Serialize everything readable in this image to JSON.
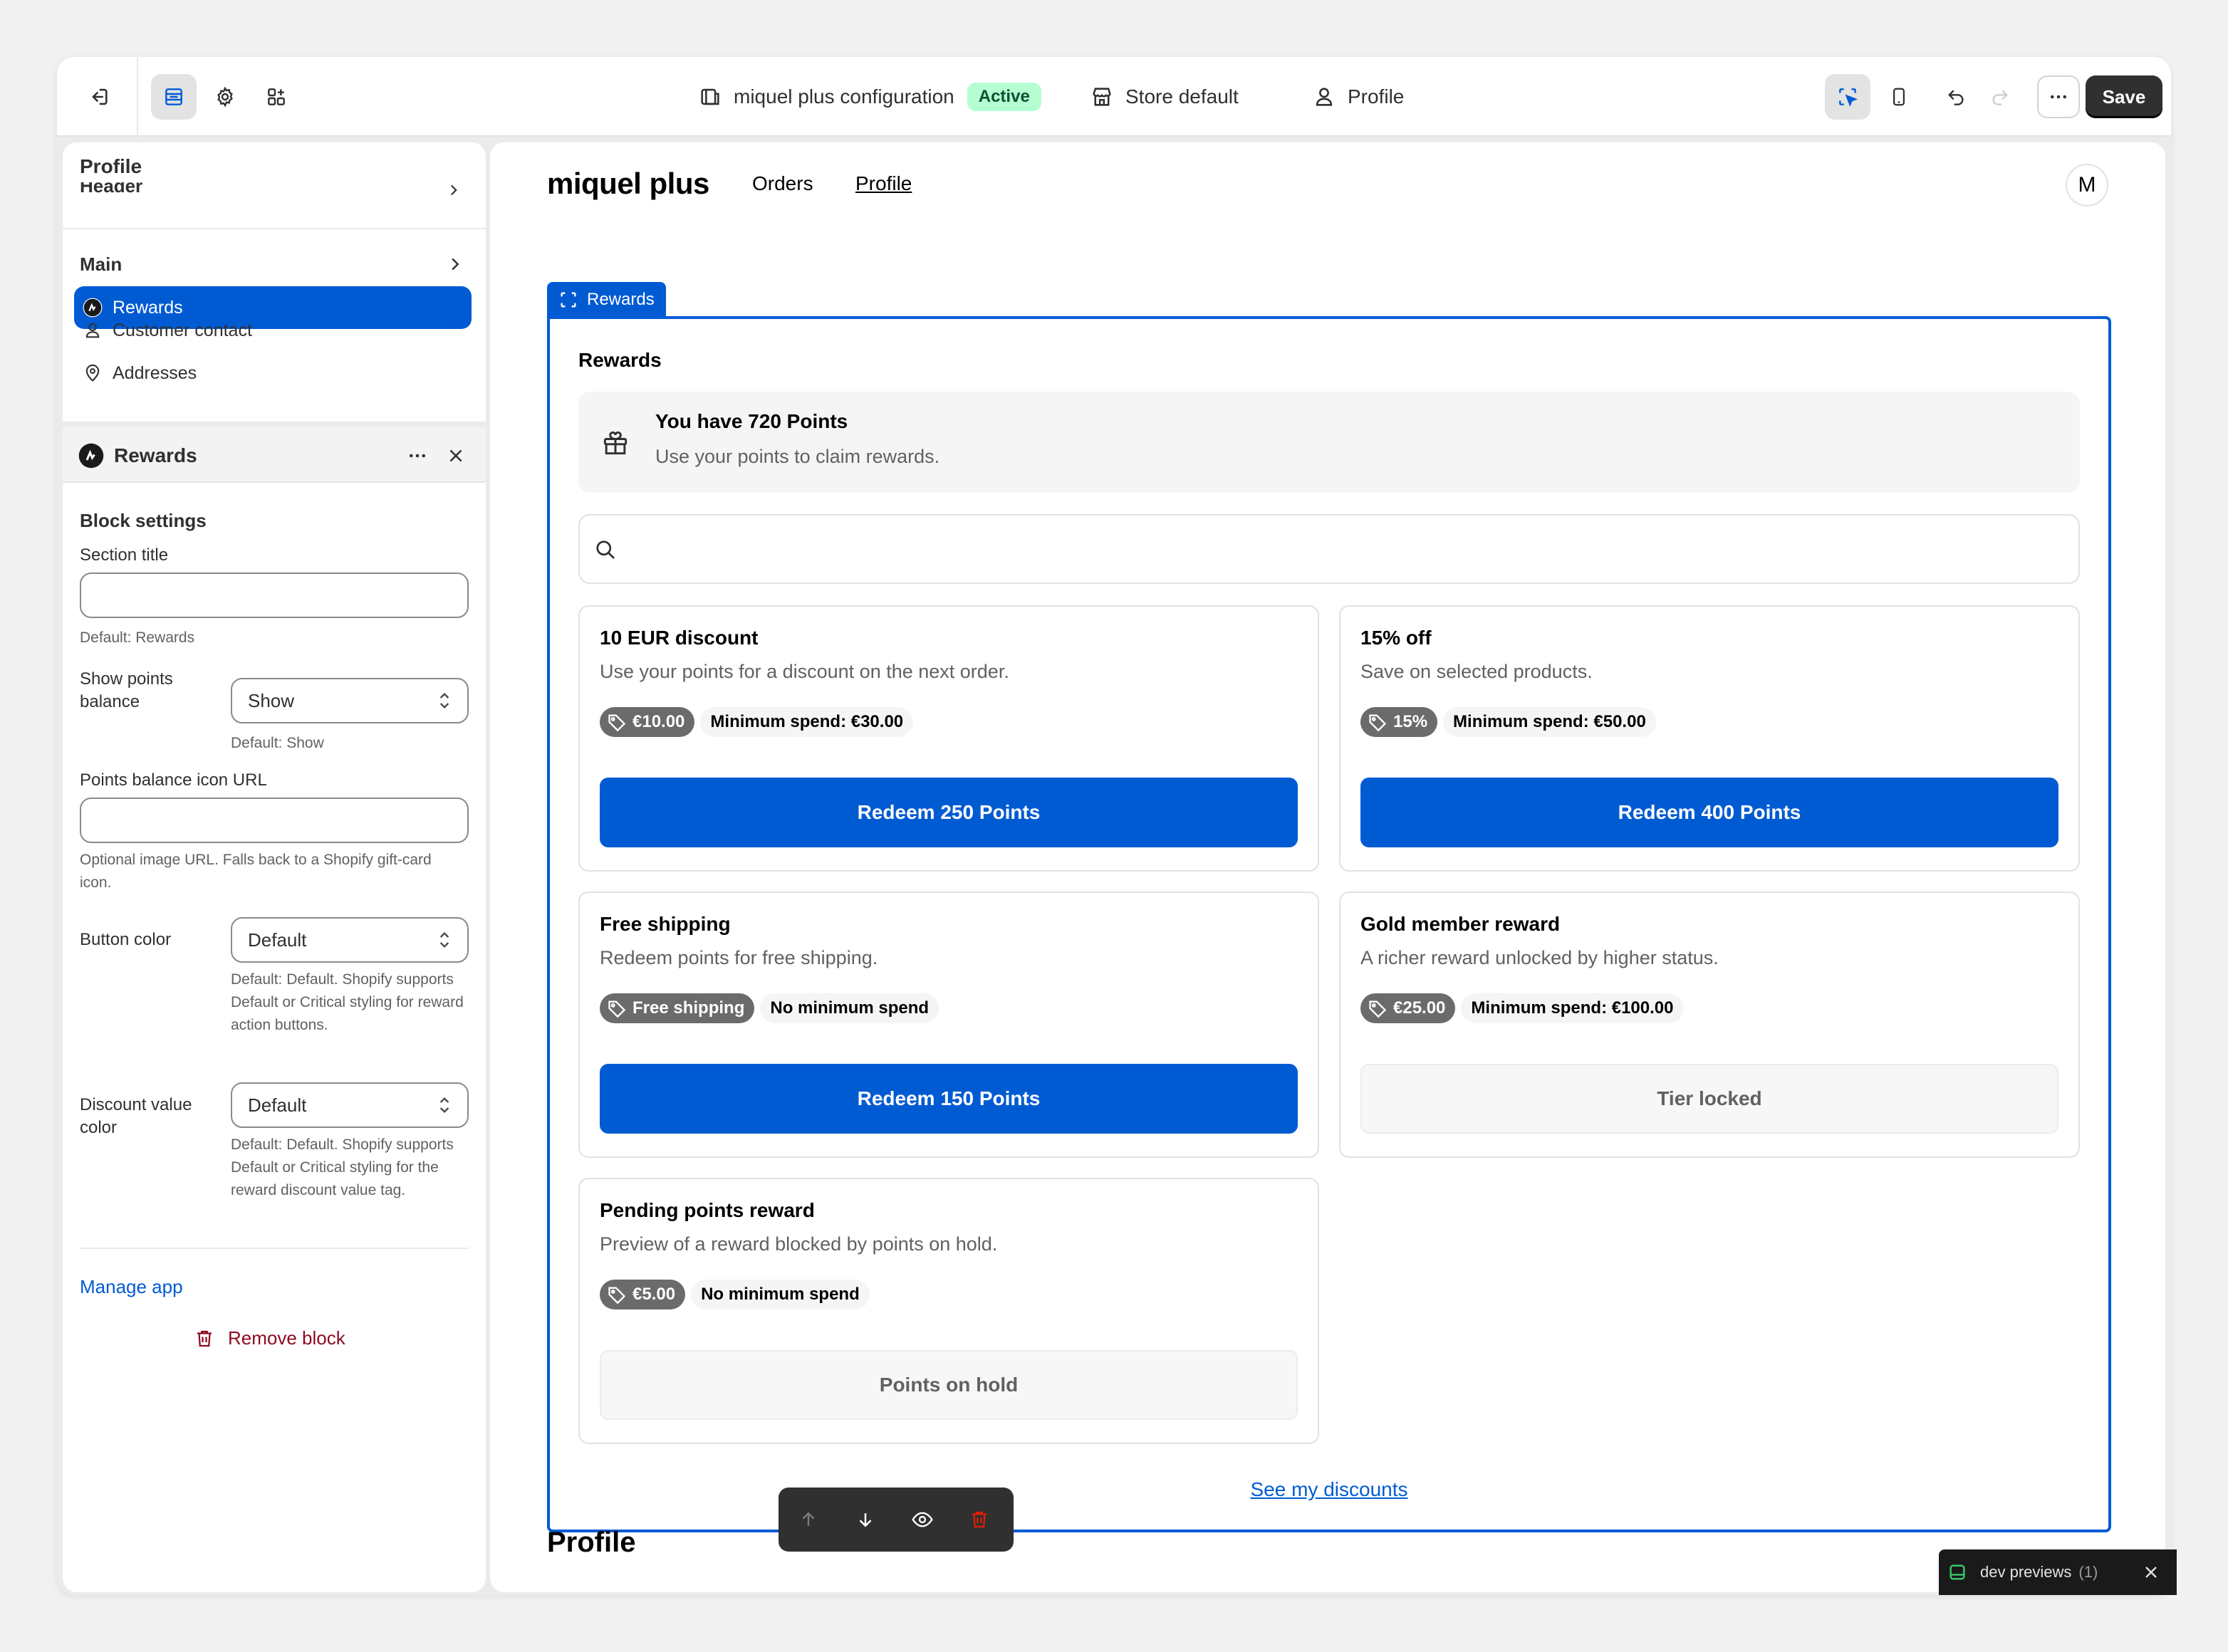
{
  "topbar": {
    "config_name": "miquel plus configuration",
    "status": "Active",
    "store": "Store default",
    "page": "Profile",
    "save_label": "Save"
  },
  "sidebar": {
    "title": "Profile",
    "header_section": "Header",
    "main_section": "Main",
    "items": [
      {
        "label": "Rewards",
        "icon": "app-icon",
        "active": true
      },
      {
        "label": "Customer contact",
        "icon": "person-icon",
        "active": false
      },
      {
        "label": "Addresses",
        "icon": "location-icon",
        "active": false
      }
    ]
  },
  "block": {
    "name": "Rewards",
    "settings_heading": "Block settings",
    "section_title_label": "Section title",
    "section_title_value": "",
    "section_title_hint": "Default: Rewards",
    "show_points_label": "Show points balance",
    "show_points_value": "Show",
    "show_points_hint": "Default: Show",
    "icon_url_label": "Points balance icon URL",
    "icon_url_value": "",
    "icon_url_hint": "Optional image URL. Falls back to a Shopify gift-card icon.",
    "button_color_label": "Button color",
    "button_color_value": "Default",
    "button_color_hint": "Default: Default. Shopify supports Default or Critical styling for reward action buttons.",
    "discount_color_label": "Discount value color",
    "discount_color_value": "Default",
    "discount_color_hint": "Default: Default. Shopify supports Default or Critical styling for the reward discount value tag.",
    "manage_app": "Manage app",
    "remove_block": "Remove block"
  },
  "preview": {
    "shop_name": "miquel plus",
    "nav": [
      "Orders",
      "Profile"
    ],
    "avatar_initial": "M",
    "section_tag": "Rewards",
    "section_title": "Rewards",
    "points_heading": "You have 720 Points",
    "points_sub": "Use your points to claim rewards.",
    "search_placeholder": "",
    "cards": [
      {
        "title": "10 EUR discount",
        "desc": "Use your points for a discount on the next order.",
        "value": "€10.00",
        "min": "Minimum spend: €30.00",
        "button": "Redeem 250 Points",
        "state": "primary"
      },
      {
        "title": "15% off",
        "desc": "Save on selected products.",
        "value": "15%",
        "min": "Minimum spend: €50.00",
        "button": "Redeem 400 Points",
        "state": "primary"
      },
      {
        "title": "Free shipping",
        "desc": "Redeem points for free shipping.",
        "value": "Free shipping",
        "min": "No minimum spend",
        "button": "Redeem 150 Points",
        "state": "primary"
      },
      {
        "title": "Gold member reward",
        "desc": "A richer reward unlocked by higher status.",
        "value": "€25.00",
        "min": "Minimum spend: €100.00",
        "button": "Tier locked",
        "state": "disabled"
      },
      {
        "title": "Pending points reward",
        "desc": "Preview of a reward blocked by points on hold.",
        "value": "€5.00",
        "min": "No minimum spend",
        "button": "Points on hold",
        "state": "disabled"
      }
    ],
    "see_discounts": "See my discounts",
    "next_section": "Profile"
  },
  "dev_toast": {
    "label": "dev previews",
    "count": "(1)"
  },
  "colors": {
    "accent": "#005bd3",
    "dark": "#303030",
    "critical": "#8e0b21",
    "success_bg": "#b4fed2"
  }
}
